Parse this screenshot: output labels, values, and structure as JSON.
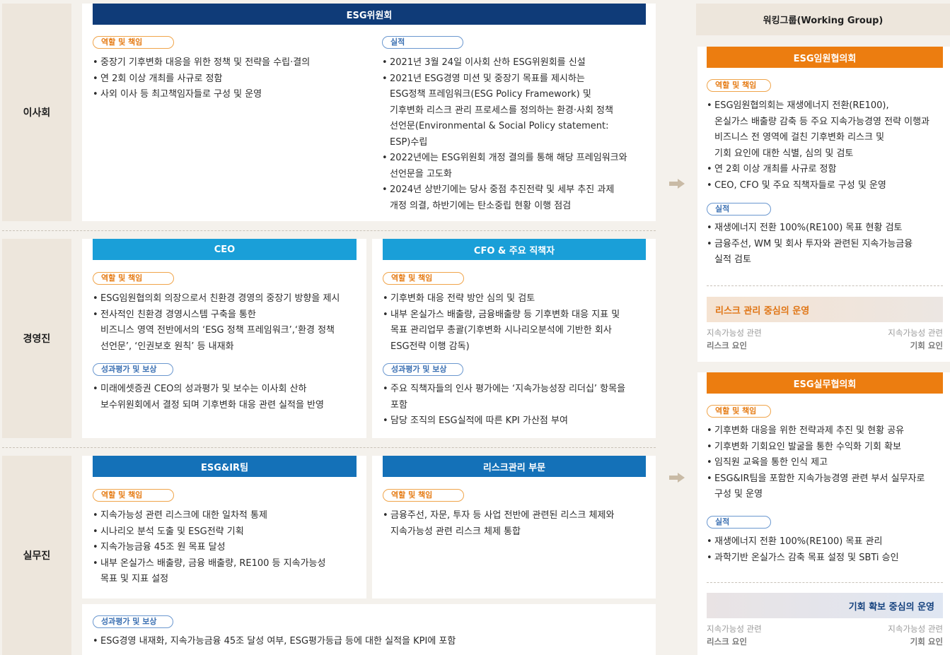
{
  "rows": {
    "board": "이사회",
    "mgmt": "경영진",
    "work": "실무진"
  },
  "board": {
    "title": "ESG위원회",
    "role_label": "역할 및 책임",
    "role_items": [
      "중장기 기후변화 대응을 위한 정책 및 전략을 수립·결의",
      "연 2회 이상 개최를 사규로 정함",
      "사외 이사 등 최고책임자들로 구성 및 운영"
    ],
    "perf_label": "실적",
    "perf_items": [
      "2021년 3월 24일 이사회 산하 ESG위원회를 신설",
      "2021년 ESG경영 미션 및 중장기 목표를 제시하는\nESG정책 프레임워크(ESG Policy Framework) 및\n기후변화 리스크 관리 프로세스를 정의하는 환경·사회 정책\n선언문(Environmental & Social Policy statement:\nESP)수립",
      "2022년에는 ESG위원회 개정 결의를 통해 해당 프레임워크와\n선언문을 고도화",
      "2024년 상반기에는 당사 중점 추진전략 및 세부 추진 과제\n개정 의결, 하반기에는 탄소중립 현황 이행 점검"
    ]
  },
  "ceo": {
    "title": "CEO",
    "role_label": "역할 및 책임",
    "role_items": [
      "ESG임원협의회 의장으로서 친환경 경영의 중장기 방향을 제시",
      "전사적인 친환경 경영시스템 구축을 통한\n비즈니스 영역 전반에서의 ‘ESG 정책 프레임워크’,‘환경 정책\n선언문’, ‘인권보호 원칙’ 등 내재화"
    ],
    "eval_label": "성과평가 및 보상",
    "eval_items": [
      "미래에셋증권 CEO의 성과평가 및 보수는 이사회 산하\n보수위원회에서 결정 되며 기후변화 대응 관련 실적을 반영"
    ]
  },
  "cfo": {
    "title": "CFO & 주요 직책자",
    "role_label": "역할 및 책임",
    "role_items": [
      "기후변화 대응 전략 방안 심의 및 검토",
      "내부 온실가스 배출량, 금융배출량 등 기후변화 대응 지표 및\n목표 관리업무 총괄(기후변화 시나리오분석에 기반한 회사\nESG전략 이행 감독)"
    ],
    "eval_label": "성과평가 및 보상",
    "eval_items": [
      "주요 직책자들의 인사 평가에는 ‘지속가능성장 리더십’ 항목을\n포함",
      "담당 조직의 ESG실적에 따른 KPI 가산점 부여"
    ]
  },
  "esgir": {
    "title": "ESG&IR팀",
    "role_label": "역할 및 책임",
    "role_items": [
      "지속가능성 관련 리스크에 대한 일차적 통제",
      "시나리오 분석 도출 및 ESG전략 기획",
      "지속가능금융 45조 원 목표 달성",
      "내부 온실가스 배출량, 금융 배출량, RE100 등 지속가능성\n목표 및 지표 설정"
    ]
  },
  "risk": {
    "title": "리스크관리 부문",
    "role_label": "역할 및 책임",
    "role_items": [
      "금융주선, 자문, 투자 등 사업 전반에 관련된 리스크 체제와\n지속가능성 관련 리스크 체제 통합"
    ]
  },
  "work_eval": {
    "label": "성과평가 및 보상",
    "items": [
      "ESG경영 내재화, 지속가능금융 45조 달성 여부, ESG평가등급 등에 대한 실적을 KPI에 포함"
    ]
  },
  "wg": {
    "title": "워킹그룹(Working Group)",
    "exec": {
      "title": "ESG임원협의회",
      "role_label": "역할 및 책임",
      "role_items": [
        "ESG임원협의회는 재생에너지 전환(RE100),\n온실가스 배출량 감축 등 주요 지속가능경영 전략 이행과\n비즈니스 전 영역에 걸친 기후변화 리스크 및\n기회 요인에 대한 식별, 심의 및 검토",
        "연 2회 이상 개최를 사규로 정함",
        "CEO, CFO 및 주요 직책자들로 구성 및 운영"
      ],
      "perf_label": "실적",
      "perf_items": [
        "재생에너지 전환 100%(RE100) 목표 현황 검토",
        "금융주선, WM 및 회사 투자와 관련된 지속가능금융\n실적 검토"
      ],
      "focus": "리스크 관리 중심의 운영",
      "left_a": "지속가능성 관련",
      "left_b": "리스크 요인",
      "right_a": "지속가능성 관련",
      "right_b": "기회 요인"
    },
    "work": {
      "title": "ESG실무협의회",
      "role_label": "역할 및 책임",
      "role_items": [
        "기후변화 대응을 위한 전략과제 추진 및 현황 공유",
        "기후변화 기회요인 발굴을 통한 수익화 기회 확보",
        "임직원 교육을 통한 인식 제고",
        "ESG&IR팀을 포함한 지속가능경영 관련 부서 실무자로\n구성 및 운영"
      ],
      "perf_label": "실적",
      "perf_items": [
        "재생에너지 전환 100%(RE100) 목표 관리",
        "과학기반 온실가스 감축 목표 설정 및 SBTi 승인"
      ],
      "focus": "기회 확보 중심의 운영",
      "left_a": "지속가능성 관련",
      "left_b": "리스크 요인",
      "right_a": "지속가능성 관련",
      "right_b": "기회 요인"
    }
  },
  "colors": {
    "navy": "#0f3b78",
    "cyan": "#1a9fd8",
    "blue": "#1471b8",
    "orange": "#ec7d10"
  }
}
